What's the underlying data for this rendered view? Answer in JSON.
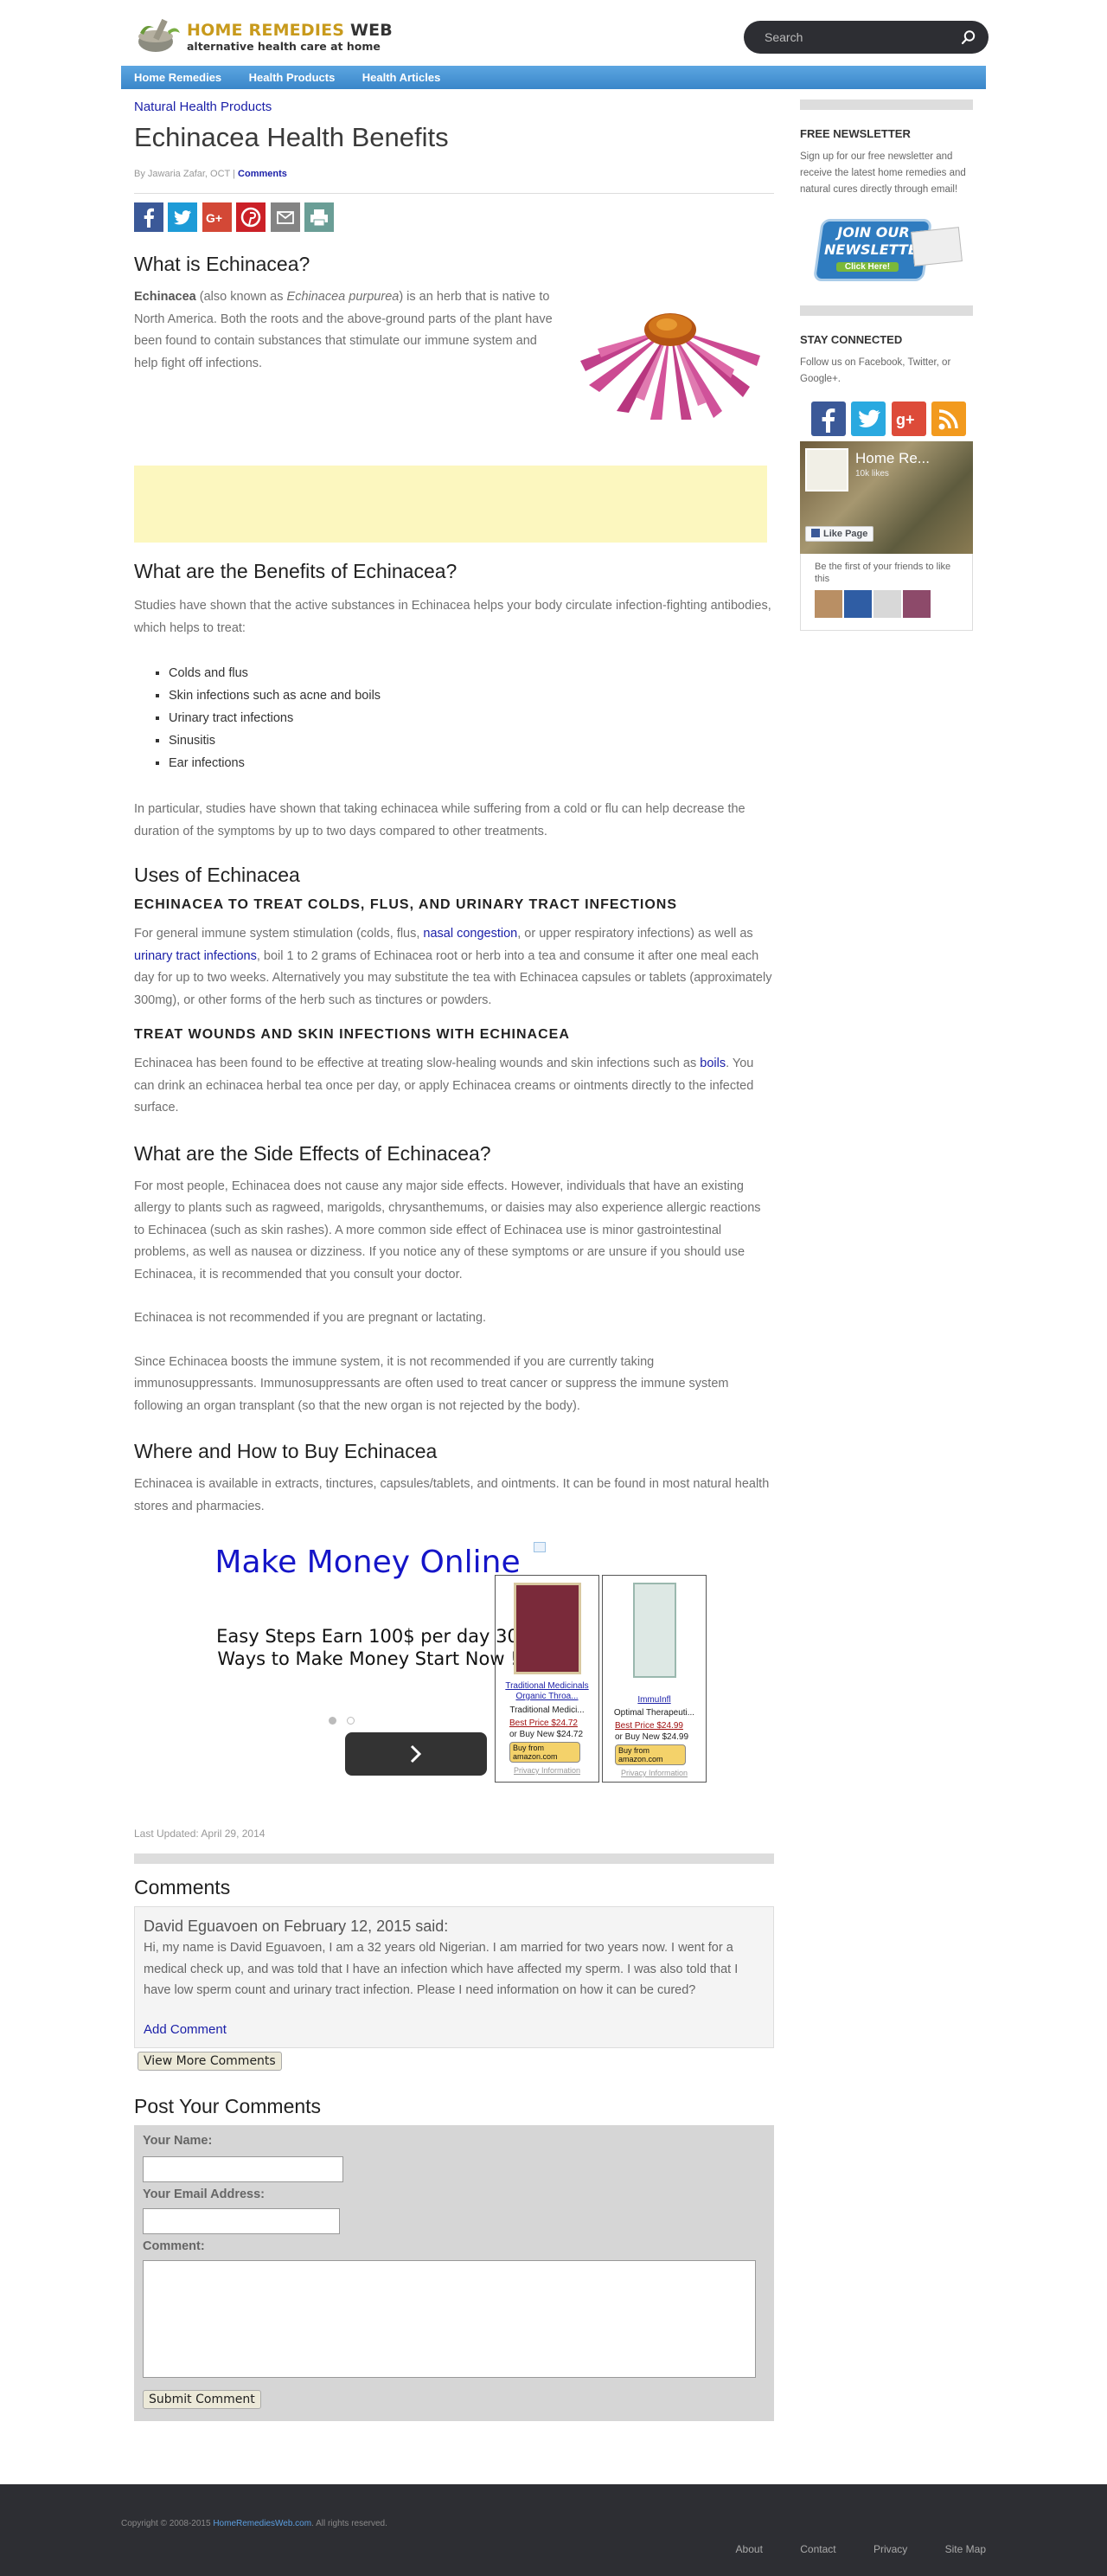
{
  "header": {
    "logo_line1_a": "HOME REMEDIES",
    "logo_line1_b": " WEB",
    "logo_tagline": "alternative health care at home",
    "search_placeholder": "Search"
  },
  "nav": [
    "Home Remedies",
    "Health Products",
    "Health Articles"
  ],
  "article": {
    "category": "Natural Health Products",
    "title": "Echinacea Health Benefits",
    "byline_prefix": "By Jawaria Zafar, OCT | ",
    "byline_link": "Comments",
    "share_icons": [
      "facebook-icon",
      "twitter-icon",
      "google-plus-icon",
      "pinterest-icon",
      "email-icon",
      "print-icon"
    ],
    "what_is": {
      "heading": "What is Echinacea?",
      "bold": "Echinacea",
      "t1": " (also known as ",
      "italic": "Echinacea purpurea",
      "t2": ") is an herb that is native to North America. Both the roots and the above-ground parts of the plant have been found to contain substances that stimulate our immune system and help fight off infections."
    },
    "benefits": {
      "heading": "What are the Benefits of Echinacea?",
      "intro": "Studies have shown that the active substances in Echinacea helps your body circulate infection-fighting antibodies, which helps to treat:",
      "items": [
        "Colds and flus",
        "Skin infections such as acne and boils",
        "Urinary tract infections",
        "Sinusitis",
        "Ear infections"
      ],
      "outro": "In particular, studies have shown that taking echinacea while suffering from a cold or flu can help decrease the duration of the symptoms by up to two days compared to other treatments."
    },
    "uses": {
      "heading": "Uses of Echinacea",
      "sub1": "Echinacea to Treat Colds, Flus, and Urinary Tract Infections",
      "p1a": "For general immune system stimulation (colds, flus, ",
      "p1_link1": "nasal congestion",
      "p1b": ", or upper respiratory infections) as well as ",
      "p1_link2": "urinary tract infections",
      "p1c": ", boil 1 to 2 grams of Echinacea root or herb into a tea and consume it after one meal each day for up to two weeks. Alternatively you may substitute the tea with Echinacea capsules or tablets (approximately 300mg), or other forms of the herb such as tinctures or powders.",
      "sub2": "Treat Wounds and Skin Infections with Echinacea",
      "p2a": "Echinacea has been found to be effective at treating slow-healing wounds and skin infections such as ",
      "p2_link": "boils",
      "p2b": ". You can drink an echinacea herbal tea once per day, or apply Echinacea creams or ointments directly to the infected surface."
    },
    "side_effects": {
      "heading": "What are the Side Effects of Echinacea?",
      "p1": "For most people, Echinacea does not cause any major side effects. However, individuals that have an existing allergy to plants such as ragweed, marigolds, chrysanthemums, or daisies may also experience allergic reactions to Echinacea (such as skin rashes). A more common side effect of Echinacea use is minor gastrointestinal problems, as well as nausea or dizziness. If you notice any of these symptoms or are unsure if you should use Echinacea, it is recommended that you consult your doctor.",
      "p2": "Echinacea is not recommended if you are pregnant or lactating.",
      "p3": "Since Echinacea boosts the immune system, it is not recommended if you are currently taking immunosuppressants. Immunosuppressants are often used to treat cancer or suppress the immune system following an organ transplant (so that the new organ is not rejected by the body)."
    },
    "buy": {
      "heading": "Where and How to Buy Echinacea",
      "p": "Echinacea is available in extracts, tinctures, capsules/tablets, and ointments. It can be found in most natural health stores and pharmacies."
    },
    "ad": {
      "title": "Make Money Online",
      "body": "Easy Steps Earn 100$ per day 30 Ways to Make Money Start Now !",
      "products": [
        {
          "name": "Traditional Medicinals Organic Throa...",
          "short": "Traditional Medici...",
          "best": "Best Price $24.72",
          "new": "or Buy New $24.72",
          "buy": "Buy from amazon.com",
          "privacy": "Privacy Information"
        },
        {
          "name": "ImmuInfl",
          "short": "Optimal Therapeuti...",
          "best": "Best Price $24.99",
          "new": "or Buy New $24.99",
          "buy": "Buy from amazon.com",
          "privacy": "Privacy Information"
        }
      ]
    },
    "last_updated": "Last Updated: April 29, 2014"
  },
  "comments": {
    "heading": "Comments",
    "items": [
      {
        "author_line": "David Eguavoen on February 12, 2015 said:",
        "text": "Hi, my name is David Eguavoen, I am a 32 years old Nigerian. I am married for two years now. I went for a medical check up, and was told that I have an infection which have affected my sperm. I was also told that I have low sperm count and urinary tract infection. Please I need information on how it can be cured?"
      }
    ],
    "add_comment": "Add Comment",
    "view_more": "View More Comments"
  },
  "post_form": {
    "heading": "Post Your Comments",
    "name_label": "Your Name:",
    "email_label": "Your Email Address:",
    "comment_label": "Comment:",
    "submit": "Submit Comment"
  },
  "sidebar": {
    "newsletter_heading": "FREE NEWSLETTER",
    "newsletter_text": "Sign up for our free newsletter and receive the latest home remedies and natural cures directly through email!",
    "newsletter_badge_1": "JOIN OUR",
    "newsletter_badge_2": "NEWSLETTER",
    "newsletter_badge_3": "Click Here!",
    "connected_heading": "STAY CONNECTED",
    "connected_text": "Follow us on Facebook, Twitter, or Google+.",
    "social_icons": [
      "facebook-icon",
      "twitter-icon",
      "google-plus-icon",
      "rss-icon"
    ],
    "fb_page_name": "Home Re...",
    "fb_likes": "10k likes",
    "fb_like_button": "Like Page",
    "fb_friends_text": "Be the first of your friends to like this"
  },
  "footer": {
    "copyright_a": "Copyright © 2008-2015 ",
    "copyright_link": "HomeRemediesWeb.com",
    "copyright_b": ". All rights reserved.",
    "links": [
      "About",
      "Contact",
      "Privacy",
      "Site Map"
    ]
  }
}
